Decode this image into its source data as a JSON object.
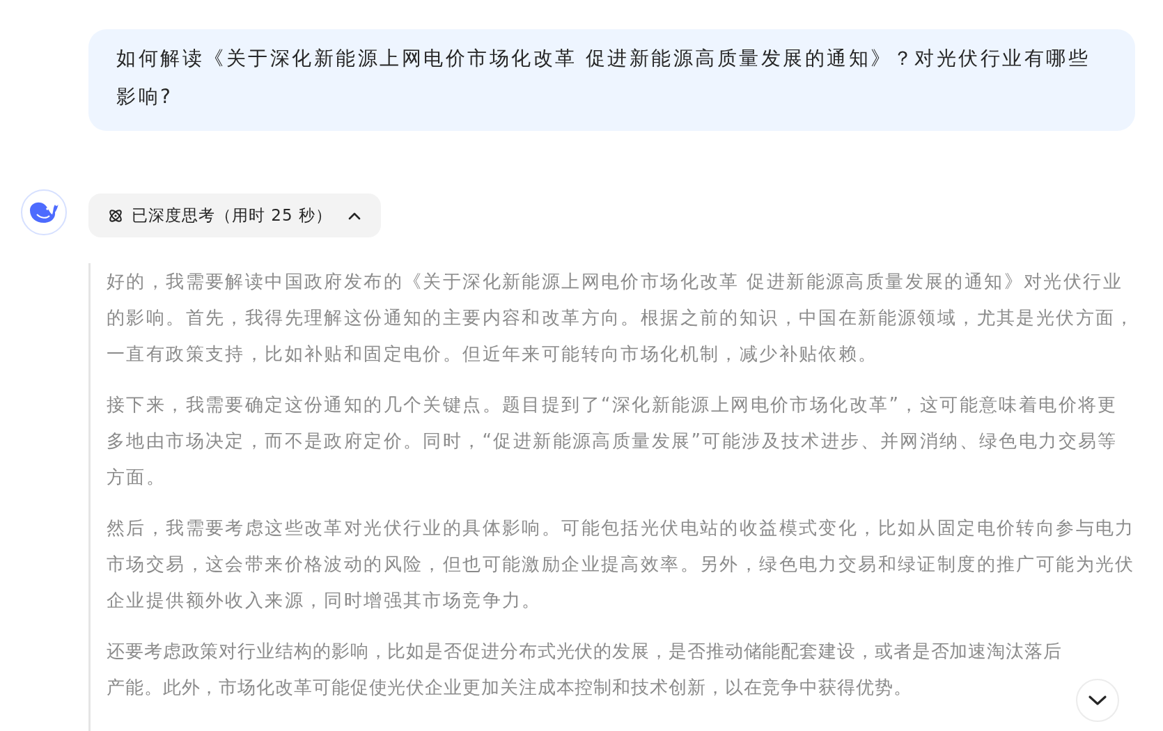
{
  "user_message": {
    "text": "如何解读《关于深化新能源上网电价市场化改革 促进新能源高质量发展的通知》？对光伏行业有哪些影响?"
  },
  "assistant": {
    "thinking": {
      "label": "已深度思考（用时 25 秒）",
      "expanded": true
    },
    "paragraphs": [
      "好的，我需要解读中国政府发布的《关于深化新能源上网电价市场化改革 促进新能源高质量发展的通知》对光伏行业的影响。首先，我得先理解这份通知的主要内容和改革方向。根据之前的知识，中国在新能源领域，尤其是光伏方面，一直有政策支持，比如补贴和固定电价。但近年来可能转向市场化机制，减少补贴依赖。",
      "接下来，我需要确定这份通知的几个关键点。题目提到了“深化新能源上网电价市场化改革”，这可能意味着电价将更多地由市场决定，而不是政府定价。同时，“促进新能源高质量发展”可能涉及技术进步、并网消纳、绿色电力交易等方面。",
      "然后，我需要考虑这些改革对光伏行业的具体影响。可能包括光伏电站的收益模式变化，比如从固定电价转向参与电力市场交易，这会带来价格波动的风险，但也可能激励企业提高效率。另外，绿色电力交易和绿证制度的推广可能为光伏企业提供额外收入来源，同时增强其市场竞争力。",
      "还要考虑政策对行业结构的影响，比如是否促进分布式光伏的发展，是否推动储能配套建设，或者是否加速淘汰落后产能。此外，市场化改革可能促使光伏企业更加关注成本控制和技术创新，以在竞争中获得优势。"
    ]
  }
}
